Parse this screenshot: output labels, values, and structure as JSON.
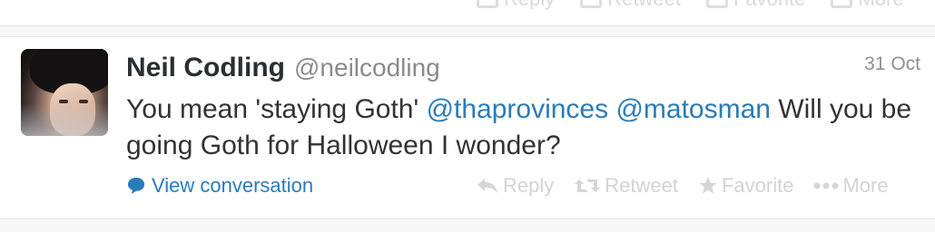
{
  "previous_tweet": {
    "actions": [
      {
        "label": "Reply",
        "icon": "reply-icon"
      },
      {
        "label": "Retweet",
        "icon": "retweet-icon"
      },
      {
        "label": "Favorite",
        "icon": "star-icon"
      },
      {
        "label": "More",
        "icon": "more-icon"
      }
    ]
  },
  "tweet": {
    "author_name": "Neil Codling",
    "author_handle": "@neilcodling",
    "timestamp": "31 Oct",
    "text_before": "You mean 'staying Goth' ",
    "mention_1": "@thaprovinces",
    "text_between": " ",
    "mention_2": "@matosman",
    "text_after": " Will you be going Goth for Halloween I wonder?",
    "view_conversation_label": "View conversation",
    "actions": {
      "reply": "Reply",
      "retweet": "Retweet",
      "favorite": "Favorite",
      "more": "More"
    }
  },
  "colors": {
    "link": "#2b7bb9",
    "name": "#292f33",
    "muted": "#8a8a8a",
    "action_disabled": "#d3d3d3"
  }
}
